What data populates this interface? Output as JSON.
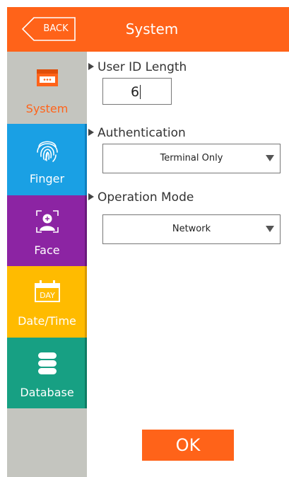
{
  "header": {
    "back_label": "BACK",
    "title": "System"
  },
  "colors": {
    "accent": "#ff6319",
    "finger": "#1aa0e4",
    "face": "#8c24a3",
    "datetime": "#ffbb00",
    "database": "#17a083",
    "sidebar_bg": "#c4c5bf"
  },
  "sidebar": {
    "items": [
      {
        "label": "System",
        "icon": "system-icon",
        "selected": true
      },
      {
        "label": "Finger",
        "icon": "fingerprint-icon"
      },
      {
        "label": "Face",
        "icon": "face-icon"
      },
      {
        "label": "Date/Time",
        "icon": "calendar-icon",
        "icon_text": "DAY"
      },
      {
        "label": "Database",
        "icon": "database-icon"
      }
    ]
  },
  "main": {
    "user_id_length": {
      "label": "User ID Length",
      "value": "6"
    },
    "authentication": {
      "label": "Authentication",
      "value": "Terminal Only"
    },
    "operation_mode": {
      "label": "Operation Mode",
      "value": "Network"
    }
  },
  "ok_label": "OK"
}
